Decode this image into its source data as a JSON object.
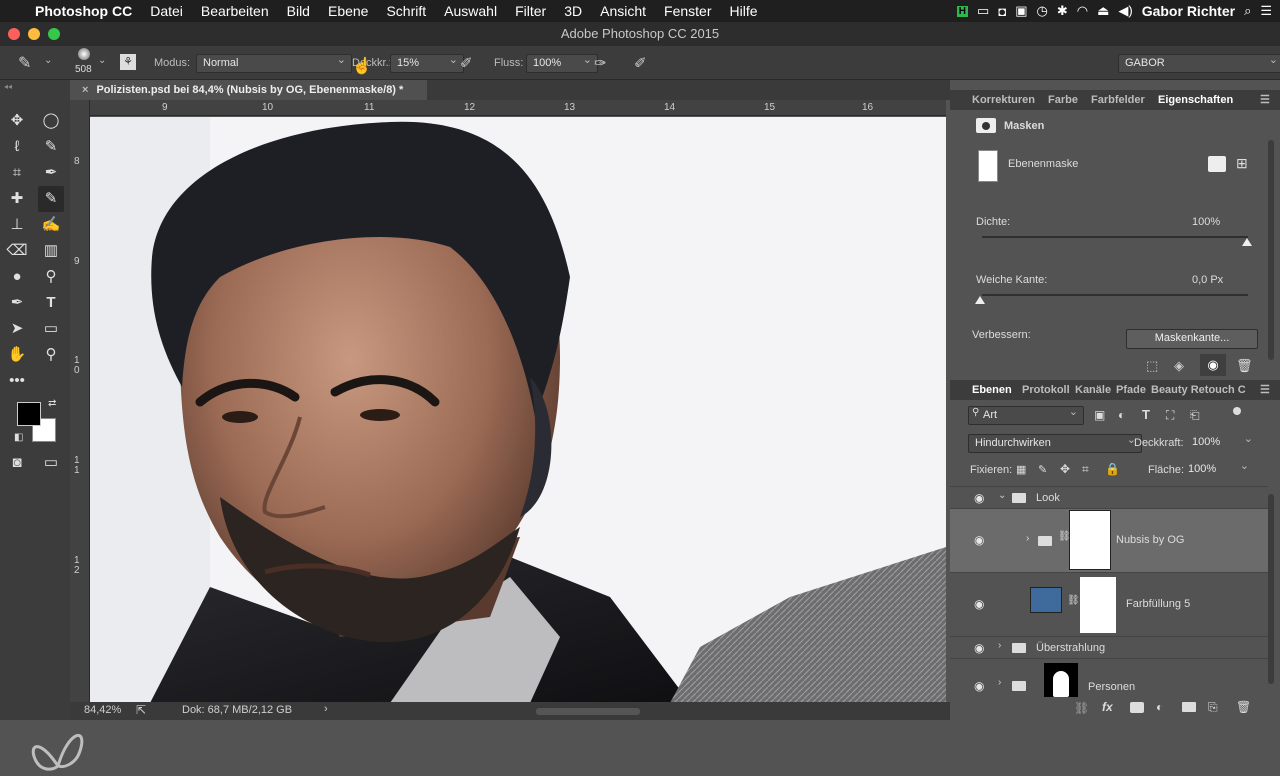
{
  "menubar": {
    "apple": "",
    "app": "Photoshop CC",
    "items": [
      "Datei",
      "Bearbeiten",
      "Bild",
      "Ebene",
      "Schrift",
      "Auswahl",
      "Filter",
      "3D",
      "Ansicht",
      "Fenster",
      "Hilfe"
    ],
    "user": "Gabor Richter"
  },
  "window": {
    "title": "Adobe Photoshop CC 2015"
  },
  "options": {
    "brush_size": "508",
    "mode_label": "Modus:",
    "mode_value": "Normal",
    "opacity_label": "Deckkr.:",
    "opacity_value": "15%",
    "flow_label": "Fluss:",
    "flow_value": "100%",
    "workspace": "GABOR"
  },
  "document": {
    "tab_title": "Polizisten.psd bei 84,4% (Nubsis by OG, Ebenenmaske/8) *",
    "ruler_top": [
      "9",
      "10",
      "11",
      "12",
      "13",
      "14",
      "15",
      "16"
    ],
    "ruler_left": [
      "8",
      "9",
      "1 0",
      "1 1",
      "1 2"
    ],
    "zoom": "84,42%",
    "doc_info": "Dok: 68,7 MB/2,12 GB"
  },
  "properties_panel": {
    "tabs": [
      "Korrekturen",
      "Farbe",
      "Farbfelder",
      "Eigenschaften"
    ],
    "active_tab": "Eigenschaften",
    "section_title": "Masken",
    "mask_name": "Ebenenmaske",
    "density_label": "Dichte:",
    "density_value": "100%",
    "feather_label": "Weiche Kante:",
    "feather_value": "0,0 Px",
    "refine_label": "Verbessern:",
    "refine_button": "Maskenkante..."
  },
  "layers_panel": {
    "tabs": [
      "Ebenen",
      "Protokoll",
      "Kanäle",
      "Pfade",
      "Beauty Retouch C"
    ],
    "active_tab": "Ebenen",
    "filter_kind": "Art",
    "blend_mode": "Hindurchwirken",
    "opacity_label": "Deckkraft:",
    "opacity_value": "100%",
    "lock_label": "Fixieren:",
    "fill_label": "Fläche:",
    "fill_value": "100%",
    "layers": [
      {
        "name": "Look"
      },
      {
        "name": "Nubsis by OG"
      },
      {
        "name": "Farbfüllung 5"
      },
      {
        "name": "Überstrahlung"
      },
      {
        "name": "Personen"
      }
    ]
  },
  "colors": {
    "fill_layer_swatch": "#3f6a9c",
    "foreground": "#000000",
    "background": "#ffffff"
  }
}
